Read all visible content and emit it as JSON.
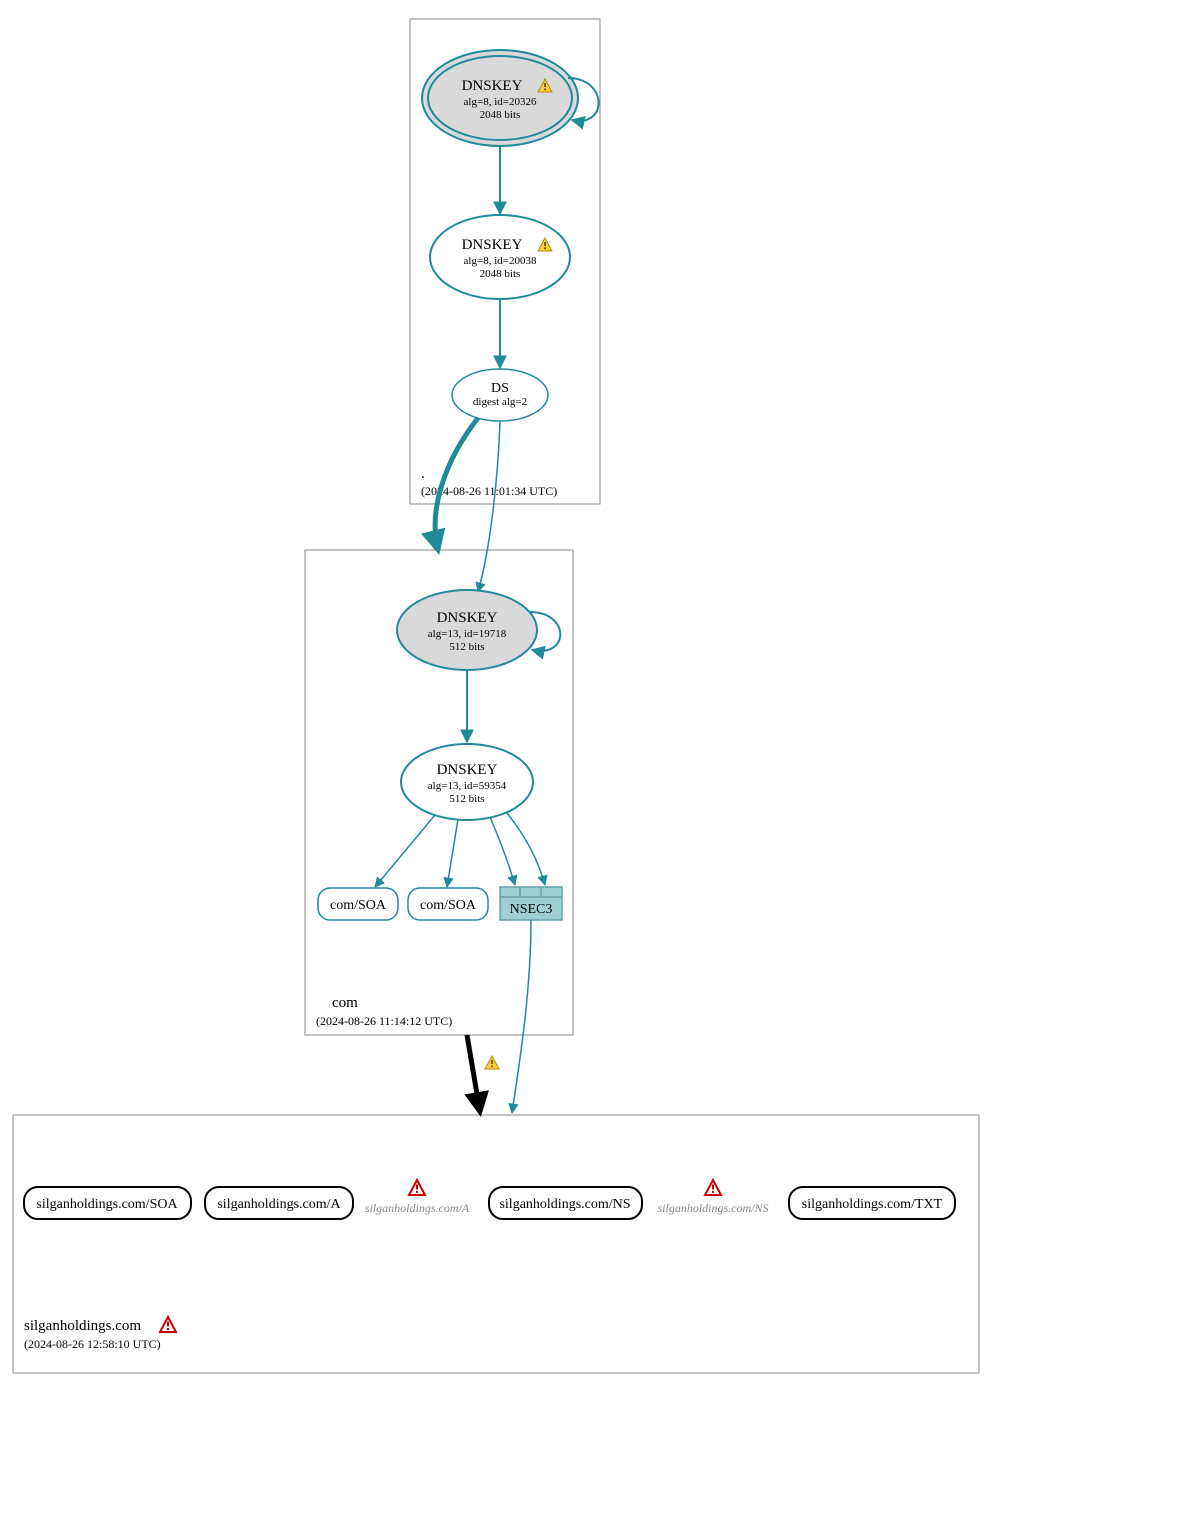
{
  "colors": {
    "teal": "#1f8a9a",
    "grey_fill": "#d9d9d9",
    "warn_fill": "#ffcf3f",
    "warn_border": "#b8860b",
    "err_border": "#cc0000",
    "nsec_fill": "#9fcfd6",
    "nsec_border": "#6aa0a8",
    "zone_border": "#888888",
    "black": "#000000"
  },
  "zones": {
    "root": {
      "label": ".",
      "timestamp": "(2024-08-26 11:01:34 UTC)"
    },
    "com": {
      "label": "com",
      "timestamp": "(2024-08-26 11:14:12 UTC)"
    },
    "leaf": {
      "label": "silganholdings.com",
      "timestamp": "(2024-08-26 12:58:10 UTC)"
    }
  },
  "nodes": {
    "root_ksk": {
      "title": "DNSKEY",
      "l2": "alg=8, id=20326",
      "l3": "2048 bits",
      "warn": true
    },
    "root_zsk": {
      "title": "DNSKEY",
      "l2": "alg=8, id=20038",
      "l3": "2048 bits",
      "warn": true
    },
    "root_ds": {
      "title": "DS",
      "l2": "digest alg=2"
    },
    "com_ksk": {
      "title": "DNSKEY",
      "l2": "alg=13, id=19718",
      "l3": "512 bits"
    },
    "com_zsk": {
      "title": "DNSKEY",
      "l2": "alg=13, id=59354",
      "l3": "512 bits"
    },
    "com_soa1": {
      "label": "com/SOA"
    },
    "com_soa2": {
      "label": "com/SOA"
    },
    "nsec3": {
      "label": "NSEC3"
    },
    "leaf_soa": {
      "label": "silganholdings.com/SOA"
    },
    "leaf_a": {
      "label": "silganholdings.com/A"
    },
    "leaf_a_g": {
      "label": "silganholdings.com/A"
    },
    "leaf_ns": {
      "label": "silganholdings.com/NS"
    },
    "leaf_ns_g": {
      "label": "silganholdings.com/NS"
    },
    "leaf_txt": {
      "label": "silganholdings.com/TXT"
    }
  }
}
